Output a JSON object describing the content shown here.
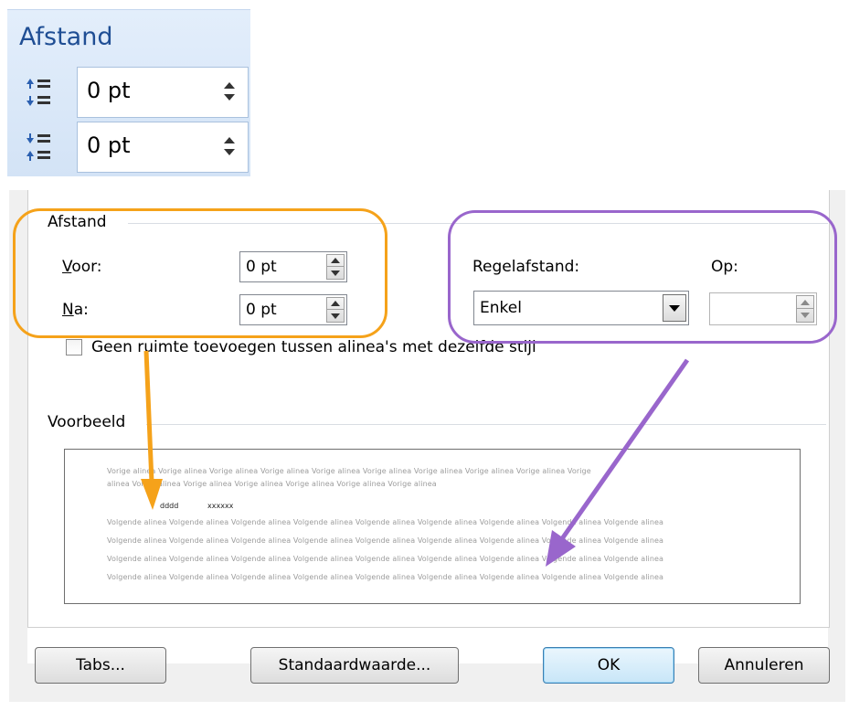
{
  "ribbon": {
    "title": "Afstand",
    "before_value": "0 pt",
    "after_value": "0 pt"
  },
  "dialog": {
    "section_spacing": "Afstand",
    "voor_label": "Voor:",
    "voor_value": "0 pt",
    "na_label": "Na:",
    "na_value": "0 pt",
    "line_spacing_label": "Regelafstand:",
    "line_spacing_value": "Enkel",
    "op_label": "Op:",
    "op_value": "",
    "checkbox_label": "Geen ruimte toevoegen tussen alinea's met dezelfde stijl",
    "section_preview": "Voorbeeld",
    "preview": {
      "prev_line1": "Vorige alinea Vorige alinea Vorige alinea Vorige alinea Vorige alinea Vorige alinea Vorige alinea Vorige alinea Vorige alinea Vorige",
      "prev_line2": "alinea Vorige alinea Vorige alinea Vorige alinea Vorige alinea Vorige alinea Vorige alinea",
      "current_a": "dddd",
      "current_b": "xxxxxx",
      "next_line": "Volgende alinea Volgende alinea Volgende alinea Volgende alinea Volgende alinea Volgende alinea Volgende alinea Volgende alinea Volgende alinea"
    },
    "buttons": {
      "tabs": "Tabs...",
      "default": "Standaardwaarde...",
      "ok": "OK",
      "cancel": "Annuleren"
    }
  },
  "colors": {
    "highlight_orange": "#f5a21a",
    "highlight_purple": "#9966cc",
    "ribbon_title": "#1f4e94"
  }
}
